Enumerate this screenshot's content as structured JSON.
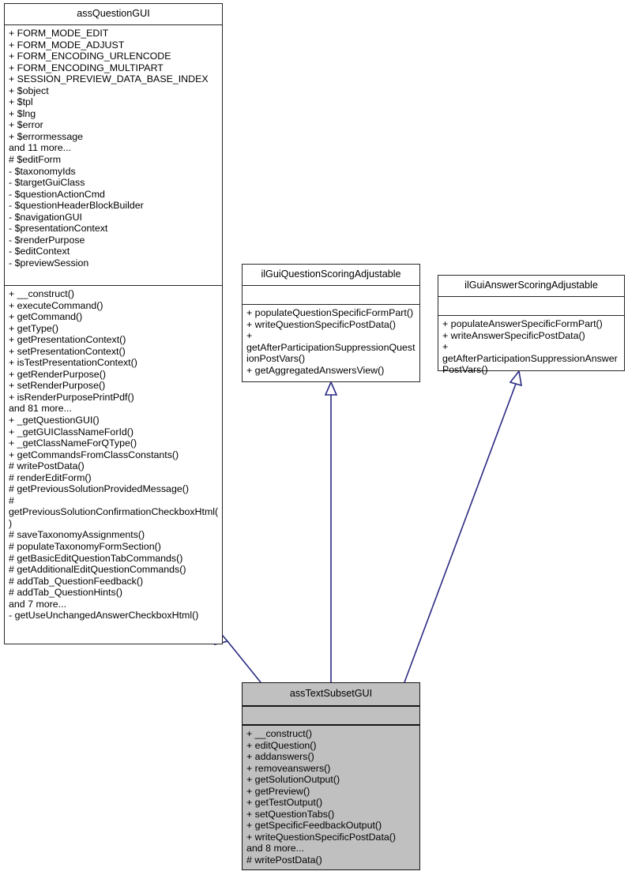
{
  "diagram": {
    "kind": "uml-inheritance-graph",
    "edge_color": "#2a2a84",
    "base_fill": "#ffffff",
    "derived_fill": "#c0c0c0",
    "border_color": "#262626"
  },
  "classes": {
    "assQuestionGUI": {
      "name": "assQuestionGUI",
      "attributes": [
        "+ FORM_MODE_EDIT",
        "+ FORM_MODE_ADJUST",
        "+ FORM_ENCODING_URLENCODE",
        "+ FORM_ENCODING_MULTIPART",
        "+ SESSION_PREVIEW_DATA_BASE_INDEX",
        "+ $object",
        "+ $tpl",
        "+ $lng",
        "+ $error",
        "+ $errormessage",
        "and 11 more...",
        "# $editForm",
        "- $taxonomyIds",
        "- $targetGuiClass",
        "- $questionActionCmd",
        "- $questionHeaderBlockBuilder",
        "- $navigationGUI",
        "- $presentationContext",
        "- $renderPurpose",
        "- $editContext",
        "- $previewSession"
      ],
      "operations": [
        "+ __construct()",
        "+ executeCommand()",
        "+ getCommand()",
        "+ getType()",
        "+ getPresentationContext()",
        "+ setPresentationContext()",
        "+ isTestPresentationContext()",
        "+ getRenderPurpose()",
        "+ setRenderPurpose()",
        "+ isRenderPurposePrintPdf()",
        "and 81 more...",
        "+ _getQuestionGUI()",
        "+ _getGUIClassNameForId()",
        "+ _getClassNameForQType()",
        "+ getCommandsFromClassConstants()",
        "# writePostData()",
        "# renderEditForm()",
        "# getPreviousSolutionProvidedMessage()",
        "# getPreviousSolutionConfirmationCheckboxHtml()",
        "# saveTaxonomyAssignments()",
        "# populateTaxonomyFormSection()",
        "# getBasicEditQuestionTabCommands()",
        "# getAdditionalEditQuestionCommands()",
        "# addTab_QuestionFeedback()",
        "# addTab_QuestionHints()",
        "and 7 more...",
        "- getUseUnchangedAnswerCheckboxHtml()"
      ]
    },
    "ilGuiQuestionScoringAdjustable": {
      "name": "ilGuiQuestionScoringAdjustable",
      "attributes": [],
      "operations": [
        "+ populateQuestionSpecificFormPart()",
        "+ writeQuestionSpecificPostData()",
        "+ getAfterParticipationSuppressionQuestionPostVars()",
        "+ getAggregatedAnswersView()"
      ]
    },
    "ilGuiAnswerScoringAdjustable": {
      "name": "ilGuiAnswerScoringAdjustable",
      "attributes": [],
      "operations": [
        "+ populateAnswerSpecificFormPart()",
        "+ writeAnswerSpecificPostData()",
        "+ getAfterParticipationSuppressionAnswerPostVars()"
      ]
    },
    "assTextSubsetGUI": {
      "name": "assTextSubsetGUI",
      "attributes": [],
      "operations": [
        "+ __construct()",
        "+ editQuestion()",
        "+ addanswers()",
        "+ removeanswers()",
        "+ getSolutionOutput()",
        "+ getPreview()",
        "+ getTestOutput()",
        "+ setQuestionTabs()",
        "+ getSpecificFeedbackOutput()",
        "+ writeQuestionSpecificPostData()",
        "and 8 more...",
        "# writePostData()"
      ]
    }
  },
  "relations": [
    {
      "from": "assTextSubsetGUI",
      "to": "assQuestionGUI",
      "type": "generalization"
    },
    {
      "from": "assTextSubsetGUI",
      "to": "ilGuiQuestionScoringAdjustable",
      "type": "realization"
    },
    {
      "from": "assTextSubsetGUI",
      "to": "ilGuiAnswerScoringAdjustable",
      "type": "realization"
    }
  ]
}
